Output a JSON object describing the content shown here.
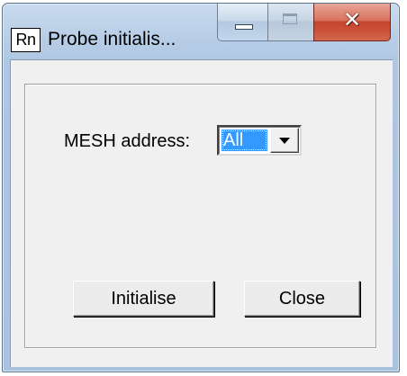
{
  "window": {
    "icon_text": "Rn",
    "title": "Probe initialis...",
    "minimize_icon": "minimize-icon",
    "maximize_icon": "maximize-icon",
    "close_icon": "close-icon",
    "close_glyph": "✕"
  },
  "form": {
    "mesh_label": "MESH address:",
    "mesh_value": "All",
    "dropdown_icon": "chevron-down-icon"
  },
  "buttons": {
    "initialise": "Initialise",
    "close": "Close"
  },
  "colors": {
    "selection": "#3399ff",
    "close_button": "#c5432b",
    "dialog_face": "#f0f0f0"
  }
}
